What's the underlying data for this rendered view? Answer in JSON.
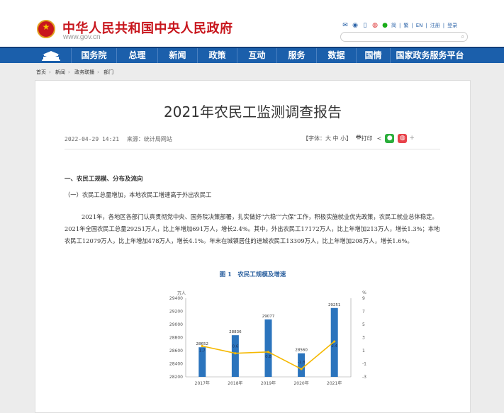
{
  "header": {
    "site_title": "中华人民共和国中央人民政府",
    "site_url": "www.gov.cn",
    "links": [
      "简",
      "繁",
      "EN",
      "注册",
      "登录"
    ],
    "search_placeholder": ""
  },
  "nav": {
    "items": [
      "国务院",
      "总理",
      "新闻",
      "政策",
      "互动",
      "服务",
      "数据",
      "国情",
      "国家政务服务平台"
    ]
  },
  "breadcrumb": [
    "首页",
    "新闻",
    "政务联播",
    "部门"
  ],
  "article": {
    "title": "2021年农民工监测调查报告",
    "date": "2022-04-29 14:21",
    "source_label": "来源：",
    "source": "统计局网站",
    "font_size_label": "【字体：大 中 小】",
    "print_label": "打印",
    "section_heading": "一、农民工规模、分布及流向",
    "sub_heading": "（一）农民工总量增加，本地农民工增速高于外出农民工",
    "paragraph": "2021年，各地区各部门认真贯彻党中央、国务院决策部署，扎实做好“六稳”“六保”工作，积极实施就业优先政策，农民工就业总体稳定。2021年全国农民工总量29251万人，比上年增加691万人，增长2.4%。其中，外出农民工17172万人，比上年增加213万人，增长1.3%；本地农民工12079万人，比上年增加478万人，增长4.1%。年末在城镇居住的进城农民工13309万人，比上年增加208万人，增长1.6%。",
    "figure_title": "图 1　农民工规模及增速",
    "trailing_text": ""
  },
  "colors": {
    "brand_red": "#c8161d",
    "nav_blue": "#1b5fab",
    "bar_blue": "#2b74bd",
    "line_yellow": "#f5b800"
  },
  "chart_data": {
    "type": "bar",
    "categories": [
      "2017年",
      "2018年",
      "2019年",
      "2020年",
      "2021年"
    ],
    "series": [
      {
        "type": "bar",
        "axis": "left",
        "values": [
          28652,
          28836,
          29077,
          28560,
          29251
        ]
      },
      {
        "type": "line",
        "axis": "right",
        "values": [
          1.7,
          0.6,
          0.8,
          -1.8,
          2.4
        ]
      }
    ],
    "y_left": {
      "unit": "万人",
      "min": 28200,
      "max": 29400,
      "ticks": [
        28200,
        28400,
        28600,
        28800,
        29000,
        29200,
        29400
      ]
    },
    "y_right": {
      "unit": "%",
      "min": -3,
      "max": 9,
      "ticks": [
        -3,
        -1,
        1,
        3,
        5,
        7,
        9
      ]
    },
    "grid": false,
    "legend": "none"
  }
}
